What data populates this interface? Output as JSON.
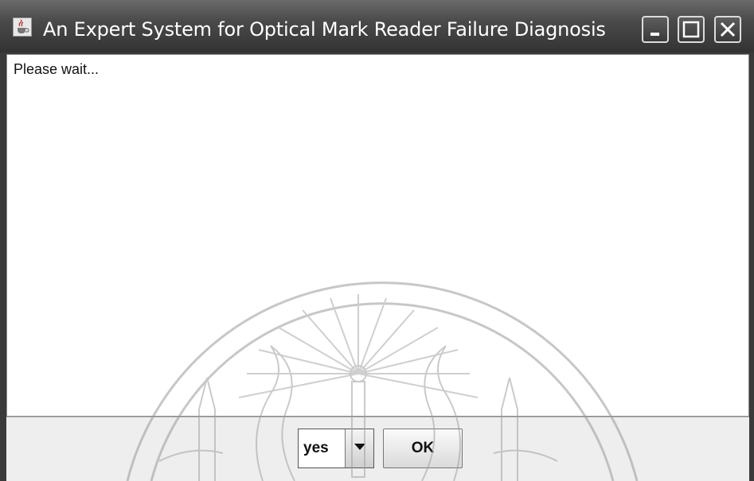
{
  "window": {
    "title": "An Expert System for Optical Mark Reader Failure Diagnosis",
    "app_icon": "java-cup-icon",
    "controls": [
      "minimize-icon",
      "maximize-icon",
      "close-icon"
    ]
  },
  "content": {
    "message": "Please wait..."
  },
  "answer": {
    "selected": "yes"
  },
  "ok_button": {
    "label": "OK"
  },
  "colors": {
    "titlebar": "#4a4a4a",
    "content_bg": "#ffffff",
    "panel_bg": "#eeeeee"
  }
}
